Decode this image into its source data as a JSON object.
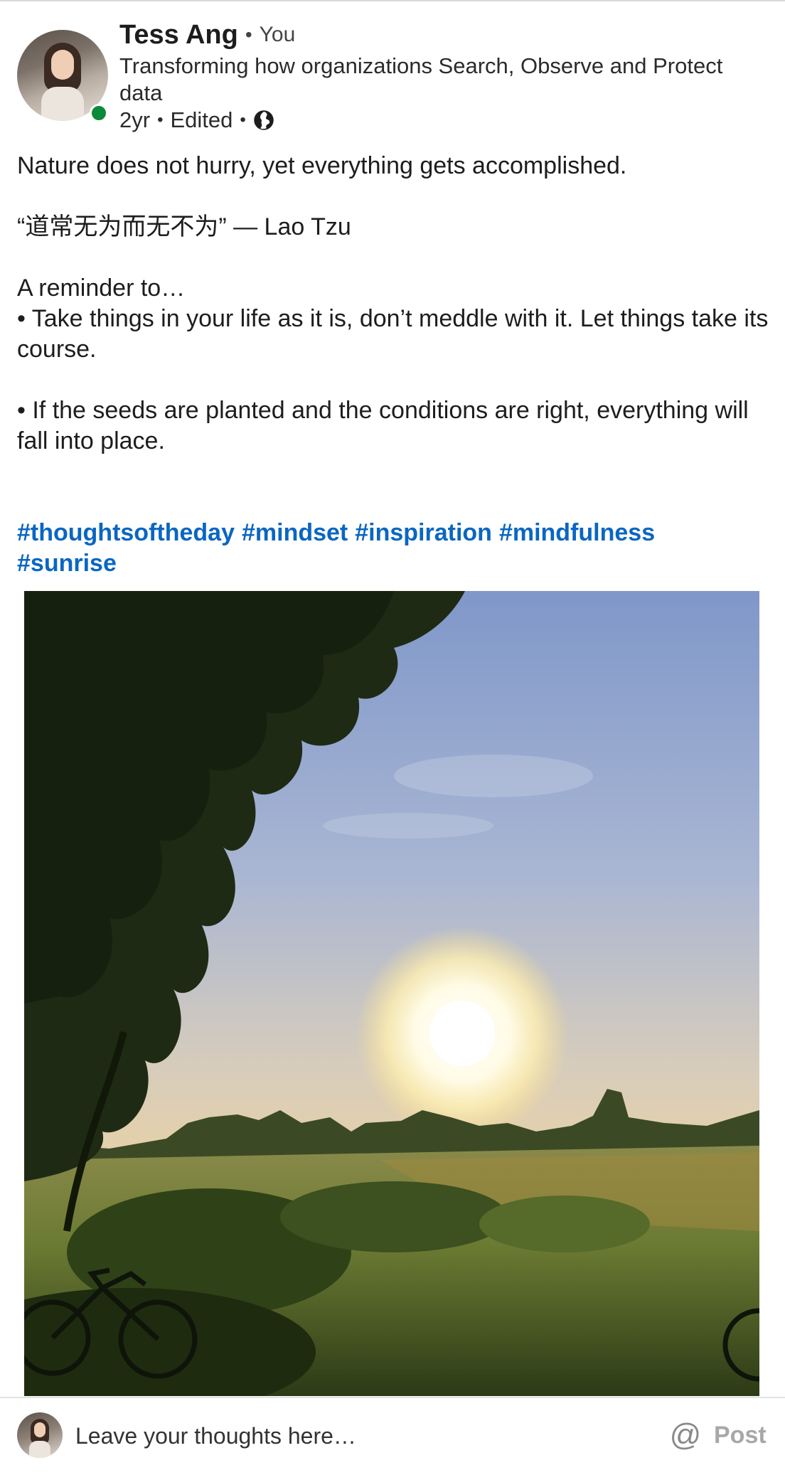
{
  "author": {
    "name": "Tess Ang",
    "relation": "You",
    "headline": "Transforming how organizations Search, Observe and Protect data",
    "age": "2yr",
    "edited": "Edited",
    "visibility_icon": "globe-icon",
    "presence_color": "#0a8a3a"
  },
  "post": {
    "lines": [
      "Nature does not hurry, yet everything gets accomplished.",
      "“道常无为而无不为” — Lao Tzu",
      "A reminder to…",
      "• Take things in your life as it is, don’t meddle with it. Let things take its course.",
      "• If the seeds are planted and the conditions are right, everything will fall into place."
    ],
    "hashtags": [
      "#thoughtsoftheday",
      "#mindset",
      "#inspiration",
      "#mindfulness",
      "#sunrise"
    ],
    "hashtag_color": "#0a66c2"
  },
  "comment_bar": {
    "placeholder": "Leave your thoughts here…",
    "mention_icon": "at-sign-icon",
    "post_label": "Post"
  }
}
